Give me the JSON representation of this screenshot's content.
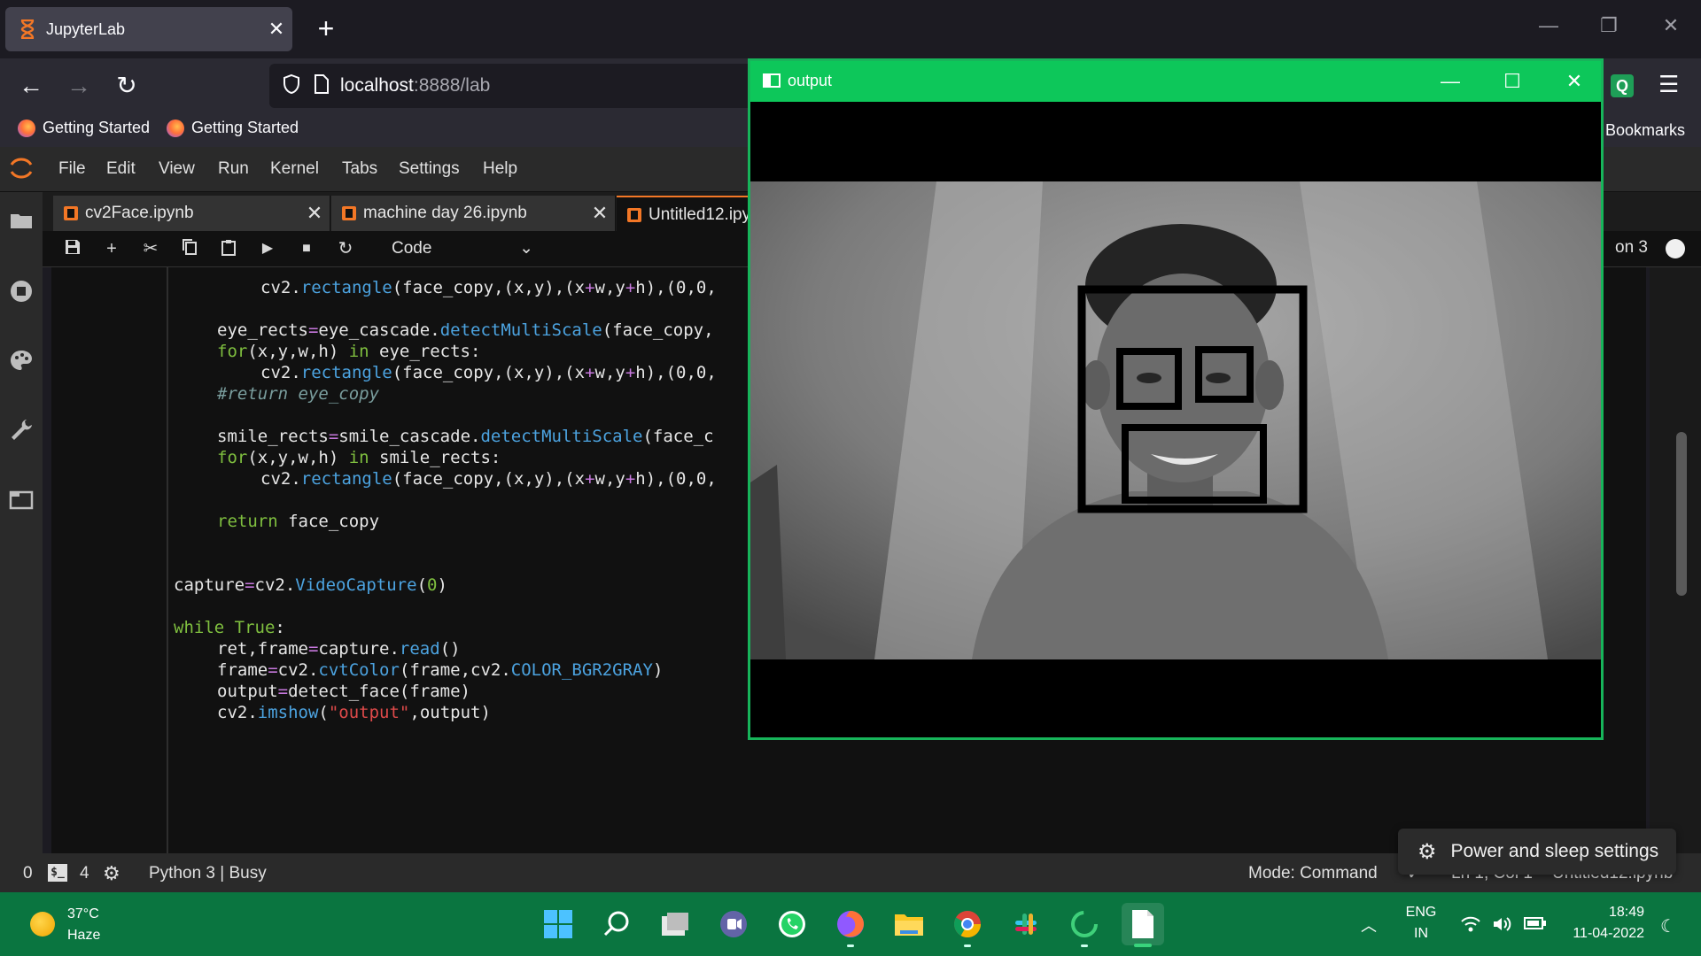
{
  "browser": {
    "tab_title": "JupyterLab",
    "url_host": "localhost",
    "url_rest": ":8888/lab",
    "bookmarks": [
      "Getting Started",
      "Getting Started"
    ],
    "bookmarks_other": "Bookmarks",
    "ext_letter": "Q"
  },
  "jupyter": {
    "menu": [
      "File",
      "Edit",
      "View",
      "Run",
      "Kernel",
      "Tabs",
      "Settings",
      "Help"
    ],
    "tabs": [
      {
        "title": "cv2Face.ipynb"
      },
      {
        "title": "machine day 26.ipynb"
      },
      {
        "title": "Untitled12.ipynb"
      }
    ],
    "cell_type": "Code",
    "kernel": "on 3"
  },
  "code_lines": [
    {
      "indent": 2,
      "parts": [
        [
          "",
          "cv2."
        ],
        [
          "fn",
          "rectangle"
        ],
        [
          "",
          "(face_copy,(x,y),(x"
        ],
        [
          "op",
          "+"
        ],
        [
          "",
          "w,y"
        ],
        [
          "op",
          "+"
        ],
        [
          "",
          "h),(0,0,"
        ]
      ]
    },
    {
      "indent": 1,
      "parts": [
        [
          "",
          "eye_rects"
        ],
        [
          "op",
          "="
        ],
        [
          "",
          "eye_cascade."
        ],
        [
          "fn",
          "detectMultiScale"
        ],
        [
          "",
          "(face_copy,"
        ]
      ]
    },
    {
      "indent": 1,
      "parts": [
        [
          "kw",
          "for"
        ],
        [
          "",
          "(x,y,w,h) "
        ],
        [
          "kw",
          "in"
        ],
        [
          "",
          " eye_rects:"
        ]
      ]
    },
    {
      "indent": 2,
      "parts": [
        [
          "",
          "cv2."
        ],
        [
          "fn",
          "rectangle"
        ],
        [
          "",
          "(face_copy,(x,y),(x"
        ],
        [
          "op",
          "+"
        ],
        [
          "",
          "w,y"
        ],
        [
          "op",
          "+"
        ],
        [
          "",
          "h),(0,0,"
        ]
      ]
    },
    {
      "indent": 1,
      "parts": [
        [
          "cm",
          "#return eye_copy"
        ]
      ]
    },
    {
      "indent": 1,
      "parts": [
        [
          "",
          "smile_rects"
        ],
        [
          "op",
          "="
        ],
        [
          "",
          "smile_cascade."
        ],
        [
          "fn",
          "detectMultiScale"
        ],
        [
          "",
          "(face_c"
        ]
      ]
    },
    {
      "indent": 1,
      "parts": [
        [
          "kw",
          "for"
        ],
        [
          "",
          "(x,y,w,h) "
        ],
        [
          "kw",
          "in"
        ],
        [
          "",
          " smile_rects:"
        ]
      ]
    },
    {
      "indent": 2,
      "parts": [
        [
          "",
          "cv2."
        ],
        [
          "fn",
          "rectangle"
        ],
        [
          "",
          "(face_copy,(x,y),(x"
        ],
        [
          "op",
          "+"
        ],
        [
          "",
          "w,y"
        ],
        [
          "op",
          "+"
        ],
        [
          "",
          "h),(0,0,"
        ]
      ]
    },
    {
      "indent": 1,
      "parts": [
        [
          "kw",
          "return"
        ],
        [
          "",
          " face_copy"
        ]
      ]
    },
    {
      "indent": 0,
      "parts": [
        [
          "",
          "capture"
        ],
        [
          "op",
          "="
        ],
        [
          "",
          "cv2."
        ],
        [
          "fn",
          "VideoCapture"
        ],
        [
          "",
          "("
        ],
        [
          "num",
          "0"
        ],
        [
          "",
          ")"
        ]
      ]
    },
    {
      "indent": 0,
      "parts": [
        [
          "kw",
          "while"
        ],
        [
          "",
          " "
        ],
        [
          "kw",
          "True"
        ],
        [
          "",
          ":"
        ]
      ]
    },
    {
      "indent": 1,
      "parts": [
        [
          "",
          "ret,frame"
        ],
        [
          "op",
          "="
        ],
        [
          "",
          "capture."
        ],
        [
          "fn",
          "read"
        ],
        [
          "",
          "()"
        ]
      ]
    },
    {
      "indent": 1,
      "parts": [
        [
          "",
          "frame"
        ],
        [
          "op",
          "="
        ],
        [
          "",
          "cv2."
        ],
        [
          "fn",
          "cvtColor"
        ],
        [
          "",
          "(frame,cv2."
        ],
        [
          "fn",
          "COLOR_BGR2GRAY"
        ],
        [
          "",
          ")"
        ]
      ]
    },
    {
      "indent": 1,
      "parts": [
        [
          "",
          "output"
        ],
        [
          "op",
          "="
        ],
        [
          "",
          "detect_face(frame)"
        ]
      ]
    },
    {
      "indent": 1,
      "parts": [
        [
          "",
          "cv2."
        ],
        [
          "fn",
          "imshow"
        ],
        [
          "",
          "("
        ],
        [
          "str",
          "\"output\""
        ],
        [
          "",
          ",output)"
        ]
      ]
    }
  ],
  "status": {
    "num1": "0",
    "num2": "4",
    "kernel_status": "Python 3 | Busy",
    "mode": "Mode: Command",
    "position": "Ln 1, Col 1",
    "file": "Untitled12.ipynb"
  },
  "output_window": {
    "title": "output"
  },
  "toast": {
    "label": "Power and sleep settings"
  },
  "taskbar": {
    "temp": "37°C",
    "condition": "Haze",
    "lang1": "ENG",
    "lang2": "IN",
    "time": "18:49",
    "date": "11-04-2022"
  }
}
